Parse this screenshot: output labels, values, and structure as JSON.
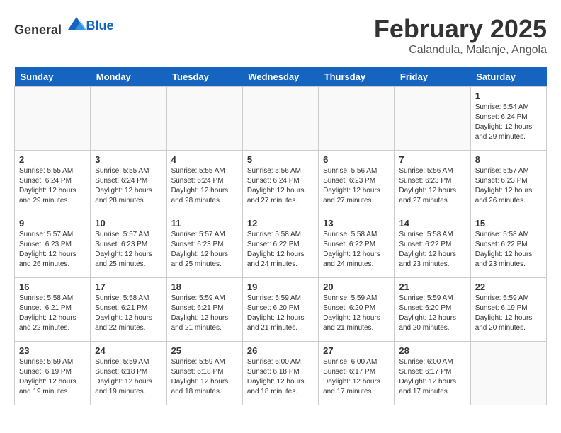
{
  "logo": {
    "general": "General",
    "blue": "Blue"
  },
  "title": "February 2025",
  "location": "Calandula, Malanje, Angola",
  "days_of_week": [
    "Sunday",
    "Monday",
    "Tuesday",
    "Wednesday",
    "Thursday",
    "Friday",
    "Saturday"
  ],
  "weeks": [
    [
      {
        "day": "",
        "info": ""
      },
      {
        "day": "",
        "info": ""
      },
      {
        "day": "",
        "info": ""
      },
      {
        "day": "",
        "info": ""
      },
      {
        "day": "",
        "info": ""
      },
      {
        "day": "",
        "info": ""
      },
      {
        "day": "1",
        "info": "Sunrise: 5:54 AM\nSunset: 6:24 PM\nDaylight: 12 hours and 29 minutes."
      }
    ],
    [
      {
        "day": "2",
        "info": "Sunrise: 5:55 AM\nSunset: 6:24 PM\nDaylight: 12 hours and 29 minutes."
      },
      {
        "day": "3",
        "info": "Sunrise: 5:55 AM\nSunset: 6:24 PM\nDaylight: 12 hours and 28 minutes."
      },
      {
        "day": "4",
        "info": "Sunrise: 5:55 AM\nSunset: 6:24 PM\nDaylight: 12 hours and 28 minutes."
      },
      {
        "day": "5",
        "info": "Sunrise: 5:56 AM\nSunset: 6:24 PM\nDaylight: 12 hours and 27 minutes."
      },
      {
        "day": "6",
        "info": "Sunrise: 5:56 AM\nSunset: 6:23 PM\nDaylight: 12 hours and 27 minutes."
      },
      {
        "day": "7",
        "info": "Sunrise: 5:56 AM\nSunset: 6:23 PM\nDaylight: 12 hours and 27 minutes."
      },
      {
        "day": "8",
        "info": "Sunrise: 5:57 AM\nSunset: 6:23 PM\nDaylight: 12 hours and 26 minutes."
      }
    ],
    [
      {
        "day": "9",
        "info": "Sunrise: 5:57 AM\nSunset: 6:23 PM\nDaylight: 12 hours and 26 minutes."
      },
      {
        "day": "10",
        "info": "Sunrise: 5:57 AM\nSunset: 6:23 PM\nDaylight: 12 hours and 25 minutes."
      },
      {
        "day": "11",
        "info": "Sunrise: 5:57 AM\nSunset: 6:23 PM\nDaylight: 12 hours and 25 minutes."
      },
      {
        "day": "12",
        "info": "Sunrise: 5:58 AM\nSunset: 6:22 PM\nDaylight: 12 hours and 24 minutes."
      },
      {
        "day": "13",
        "info": "Sunrise: 5:58 AM\nSunset: 6:22 PM\nDaylight: 12 hours and 24 minutes."
      },
      {
        "day": "14",
        "info": "Sunrise: 5:58 AM\nSunset: 6:22 PM\nDaylight: 12 hours and 23 minutes."
      },
      {
        "day": "15",
        "info": "Sunrise: 5:58 AM\nSunset: 6:22 PM\nDaylight: 12 hours and 23 minutes."
      }
    ],
    [
      {
        "day": "16",
        "info": "Sunrise: 5:58 AM\nSunset: 6:21 PM\nDaylight: 12 hours and 22 minutes."
      },
      {
        "day": "17",
        "info": "Sunrise: 5:58 AM\nSunset: 6:21 PM\nDaylight: 12 hours and 22 minutes."
      },
      {
        "day": "18",
        "info": "Sunrise: 5:59 AM\nSunset: 6:21 PM\nDaylight: 12 hours and 21 minutes."
      },
      {
        "day": "19",
        "info": "Sunrise: 5:59 AM\nSunset: 6:20 PM\nDaylight: 12 hours and 21 minutes."
      },
      {
        "day": "20",
        "info": "Sunrise: 5:59 AM\nSunset: 6:20 PM\nDaylight: 12 hours and 21 minutes."
      },
      {
        "day": "21",
        "info": "Sunrise: 5:59 AM\nSunset: 6:20 PM\nDaylight: 12 hours and 20 minutes."
      },
      {
        "day": "22",
        "info": "Sunrise: 5:59 AM\nSunset: 6:19 PM\nDaylight: 12 hours and 20 minutes."
      }
    ],
    [
      {
        "day": "23",
        "info": "Sunrise: 5:59 AM\nSunset: 6:19 PM\nDaylight: 12 hours and 19 minutes."
      },
      {
        "day": "24",
        "info": "Sunrise: 5:59 AM\nSunset: 6:18 PM\nDaylight: 12 hours and 19 minutes."
      },
      {
        "day": "25",
        "info": "Sunrise: 5:59 AM\nSunset: 6:18 PM\nDaylight: 12 hours and 18 minutes."
      },
      {
        "day": "26",
        "info": "Sunrise: 6:00 AM\nSunset: 6:18 PM\nDaylight: 12 hours and 18 minutes."
      },
      {
        "day": "27",
        "info": "Sunrise: 6:00 AM\nSunset: 6:17 PM\nDaylight: 12 hours and 17 minutes."
      },
      {
        "day": "28",
        "info": "Sunrise: 6:00 AM\nSunset: 6:17 PM\nDaylight: 12 hours and 17 minutes."
      },
      {
        "day": "",
        "info": ""
      }
    ]
  ]
}
